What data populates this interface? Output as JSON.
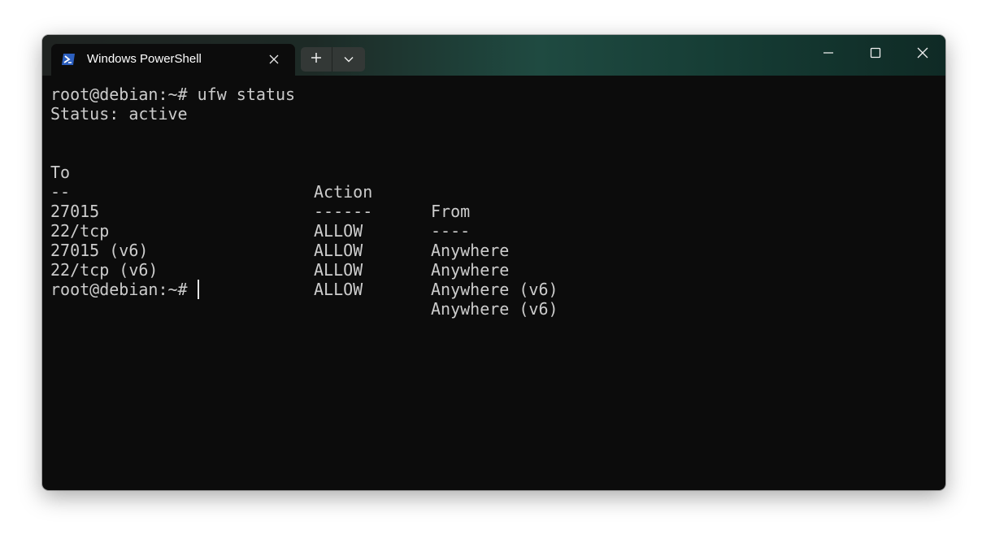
{
  "window": {
    "tab_title": "Windows PowerShell",
    "tab_icon": "powershell-icon",
    "new_tab_icon": "plus-icon",
    "dropdown_icon": "chevron-down-icon",
    "minimize_icon": "minimize-icon",
    "maximize_icon": "maximize-icon",
    "close_icon": "close-icon"
  },
  "terminal": {
    "command_line": "root@debian:~# ufw status",
    "status_line": "Status: active",
    "headers": {
      "to": "To",
      "action": "Action",
      "from": "From"
    },
    "underlines": {
      "to": "--",
      "action": "------",
      "from": "----"
    },
    "rules": [
      {
        "to": "27015",
        "action": "ALLOW",
        "from": "Anywhere"
      },
      {
        "to": "22/tcp",
        "action": "ALLOW",
        "from": "Anywhere"
      },
      {
        "to": "27015 (v6)",
        "action": "ALLOW",
        "from": "Anywhere (v6)"
      },
      {
        "to": "22/tcp (v6)",
        "action": "ALLOW",
        "from": "Anywhere (v6)"
      }
    ],
    "prompt": "root@debian:~#"
  },
  "colors": {
    "background": "#0c0c0c",
    "text": "#cccccc",
    "accent": "#1f4a41"
  }
}
